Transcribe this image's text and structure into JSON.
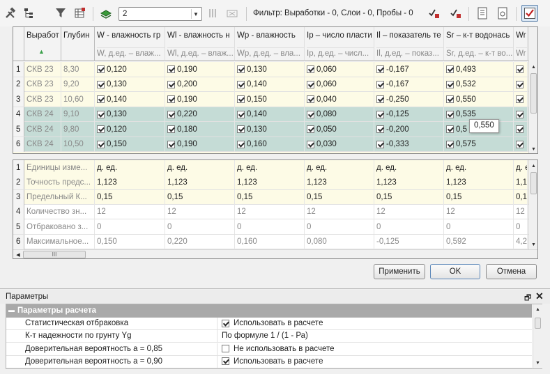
{
  "toolbar": {
    "combo_value": "2",
    "filter_text": "Фильтр: Выработки - 0, Слои - 0, Пробы - 0"
  },
  "main_grid": {
    "headers": [
      {
        "title": "Выработ",
        "sub": ""
      },
      {
        "title": "Глубин",
        "sub": ""
      },
      {
        "title": "W - влажность гр",
        "sub": "W, д.ед. – влаж..."
      },
      {
        "title": "Wl - влажность н",
        "sub": "Wl, д.ед. – влаж..."
      },
      {
        "title": "Wp - влажность",
        "sub": "Wp, д.ед. – вла..."
      },
      {
        "title": "Ip – число пласти",
        "sub": "Ip, д.ед. – числ..."
      },
      {
        "title": "Il – показатель те",
        "sub": "Il, д.ед. – показ..."
      },
      {
        "title": "Sr – к-т водонась",
        "sub": "Sr, д.ед. – к-т во..."
      },
      {
        "title": "Wr",
        "sub": "Wr"
      }
    ],
    "rows": [
      {
        "num": "1",
        "well": "СКВ 23",
        "depth": "8,30",
        "values": [
          "0,120",
          "0,190",
          "0,130",
          "0,060",
          "-0,167",
          "0,493"
        ]
      },
      {
        "num": "2",
        "well": "СКВ 23",
        "depth": "9,20",
        "values": [
          "0,130",
          "0,200",
          "0,140",
          "0,060",
          "-0,167",
          "0,532"
        ]
      },
      {
        "num": "3",
        "well": "СКВ 23",
        "depth": "10,60",
        "values": [
          "0,140",
          "0,190",
          "0,150",
          "0,040",
          "-0,250",
          "0,550"
        ]
      },
      {
        "num": "4",
        "well": "СКВ 24",
        "depth": "9,10",
        "values": [
          "0,130",
          "0,220",
          "0,140",
          "0,080",
          "-0,125",
          "0,535"
        ]
      },
      {
        "num": "5",
        "well": "СКВ 24",
        "depth": "9,80",
        "values": [
          "0,120",
          "0,180",
          "0,130",
          "0,050",
          "-0,200",
          "0,5"
        ]
      },
      {
        "num": "6",
        "well": "СКВ 24",
        "depth": "10,50",
        "values": [
          "0,150",
          "0,190",
          "0,160",
          "0,030",
          "-0,333",
          "0,575"
        ]
      }
    ],
    "tooltip": "0,550"
  },
  "stats_grid": {
    "rows": [
      {
        "num": "1",
        "label": "Единицы изме...",
        "values": [
          "д. ед.",
          "д. ед.",
          "д. ед.",
          "д. ед.",
          "д. ед.",
          "д. ед.",
          "д. е"
        ]
      },
      {
        "num": "2",
        "label": "Точность предс...",
        "values": [
          "1,123",
          "1,123",
          "1,123",
          "1,123",
          "1,123",
          "1,123",
          "1,1"
        ]
      },
      {
        "num": "3",
        "label": "Предельный К...",
        "values": [
          "0,15",
          "0,15",
          "0,15",
          "0,15",
          "0,15",
          "0,15",
          "0,1"
        ]
      },
      {
        "num": "4",
        "label": "Количество зн...",
        "values": [
          "12",
          "12",
          "12",
          "12",
          "12",
          "12",
          "12"
        ]
      },
      {
        "num": "5",
        "label": "Отбраковано з...",
        "values": [
          "0",
          "0",
          "0",
          "0",
          "0",
          "0",
          "0"
        ]
      },
      {
        "num": "6",
        "label": "Максимальное...",
        "values": [
          "0,150",
          "0,220",
          "0,160",
          "0,080",
          "-0,125",
          "0,592",
          "4,2"
        ]
      }
    ],
    "hscroll_grip": "III"
  },
  "buttons": {
    "apply": "Применить",
    "ok": "OK",
    "cancel": "Отмена"
  },
  "params": {
    "title": "Параметры",
    "section": "Параметры расчета",
    "rows": [
      {
        "label": "Статистическая отбраковка",
        "value": "Использовать в расчете",
        "checked": true
      },
      {
        "label": "К-т надежности по грунту Yg",
        "value": "По формуле 1 / (1 - Ра)",
        "checked": null
      },
      {
        "label": "Доверительная вероятность a = 0,85",
        "value": "Не использовать в расчете",
        "checked": false
      },
      {
        "label": "Доверительная вероятность a = 0,90",
        "value": "Использовать в расчете",
        "checked": true
      }
    ]
  },
  "colors": {
    "row_cream": "#fdfbe6",
    "row_teal": "#c5dcd6",
    "header_bg": "#f3f3f3",
    "section_header": "#a9a9a9"
  }
}
